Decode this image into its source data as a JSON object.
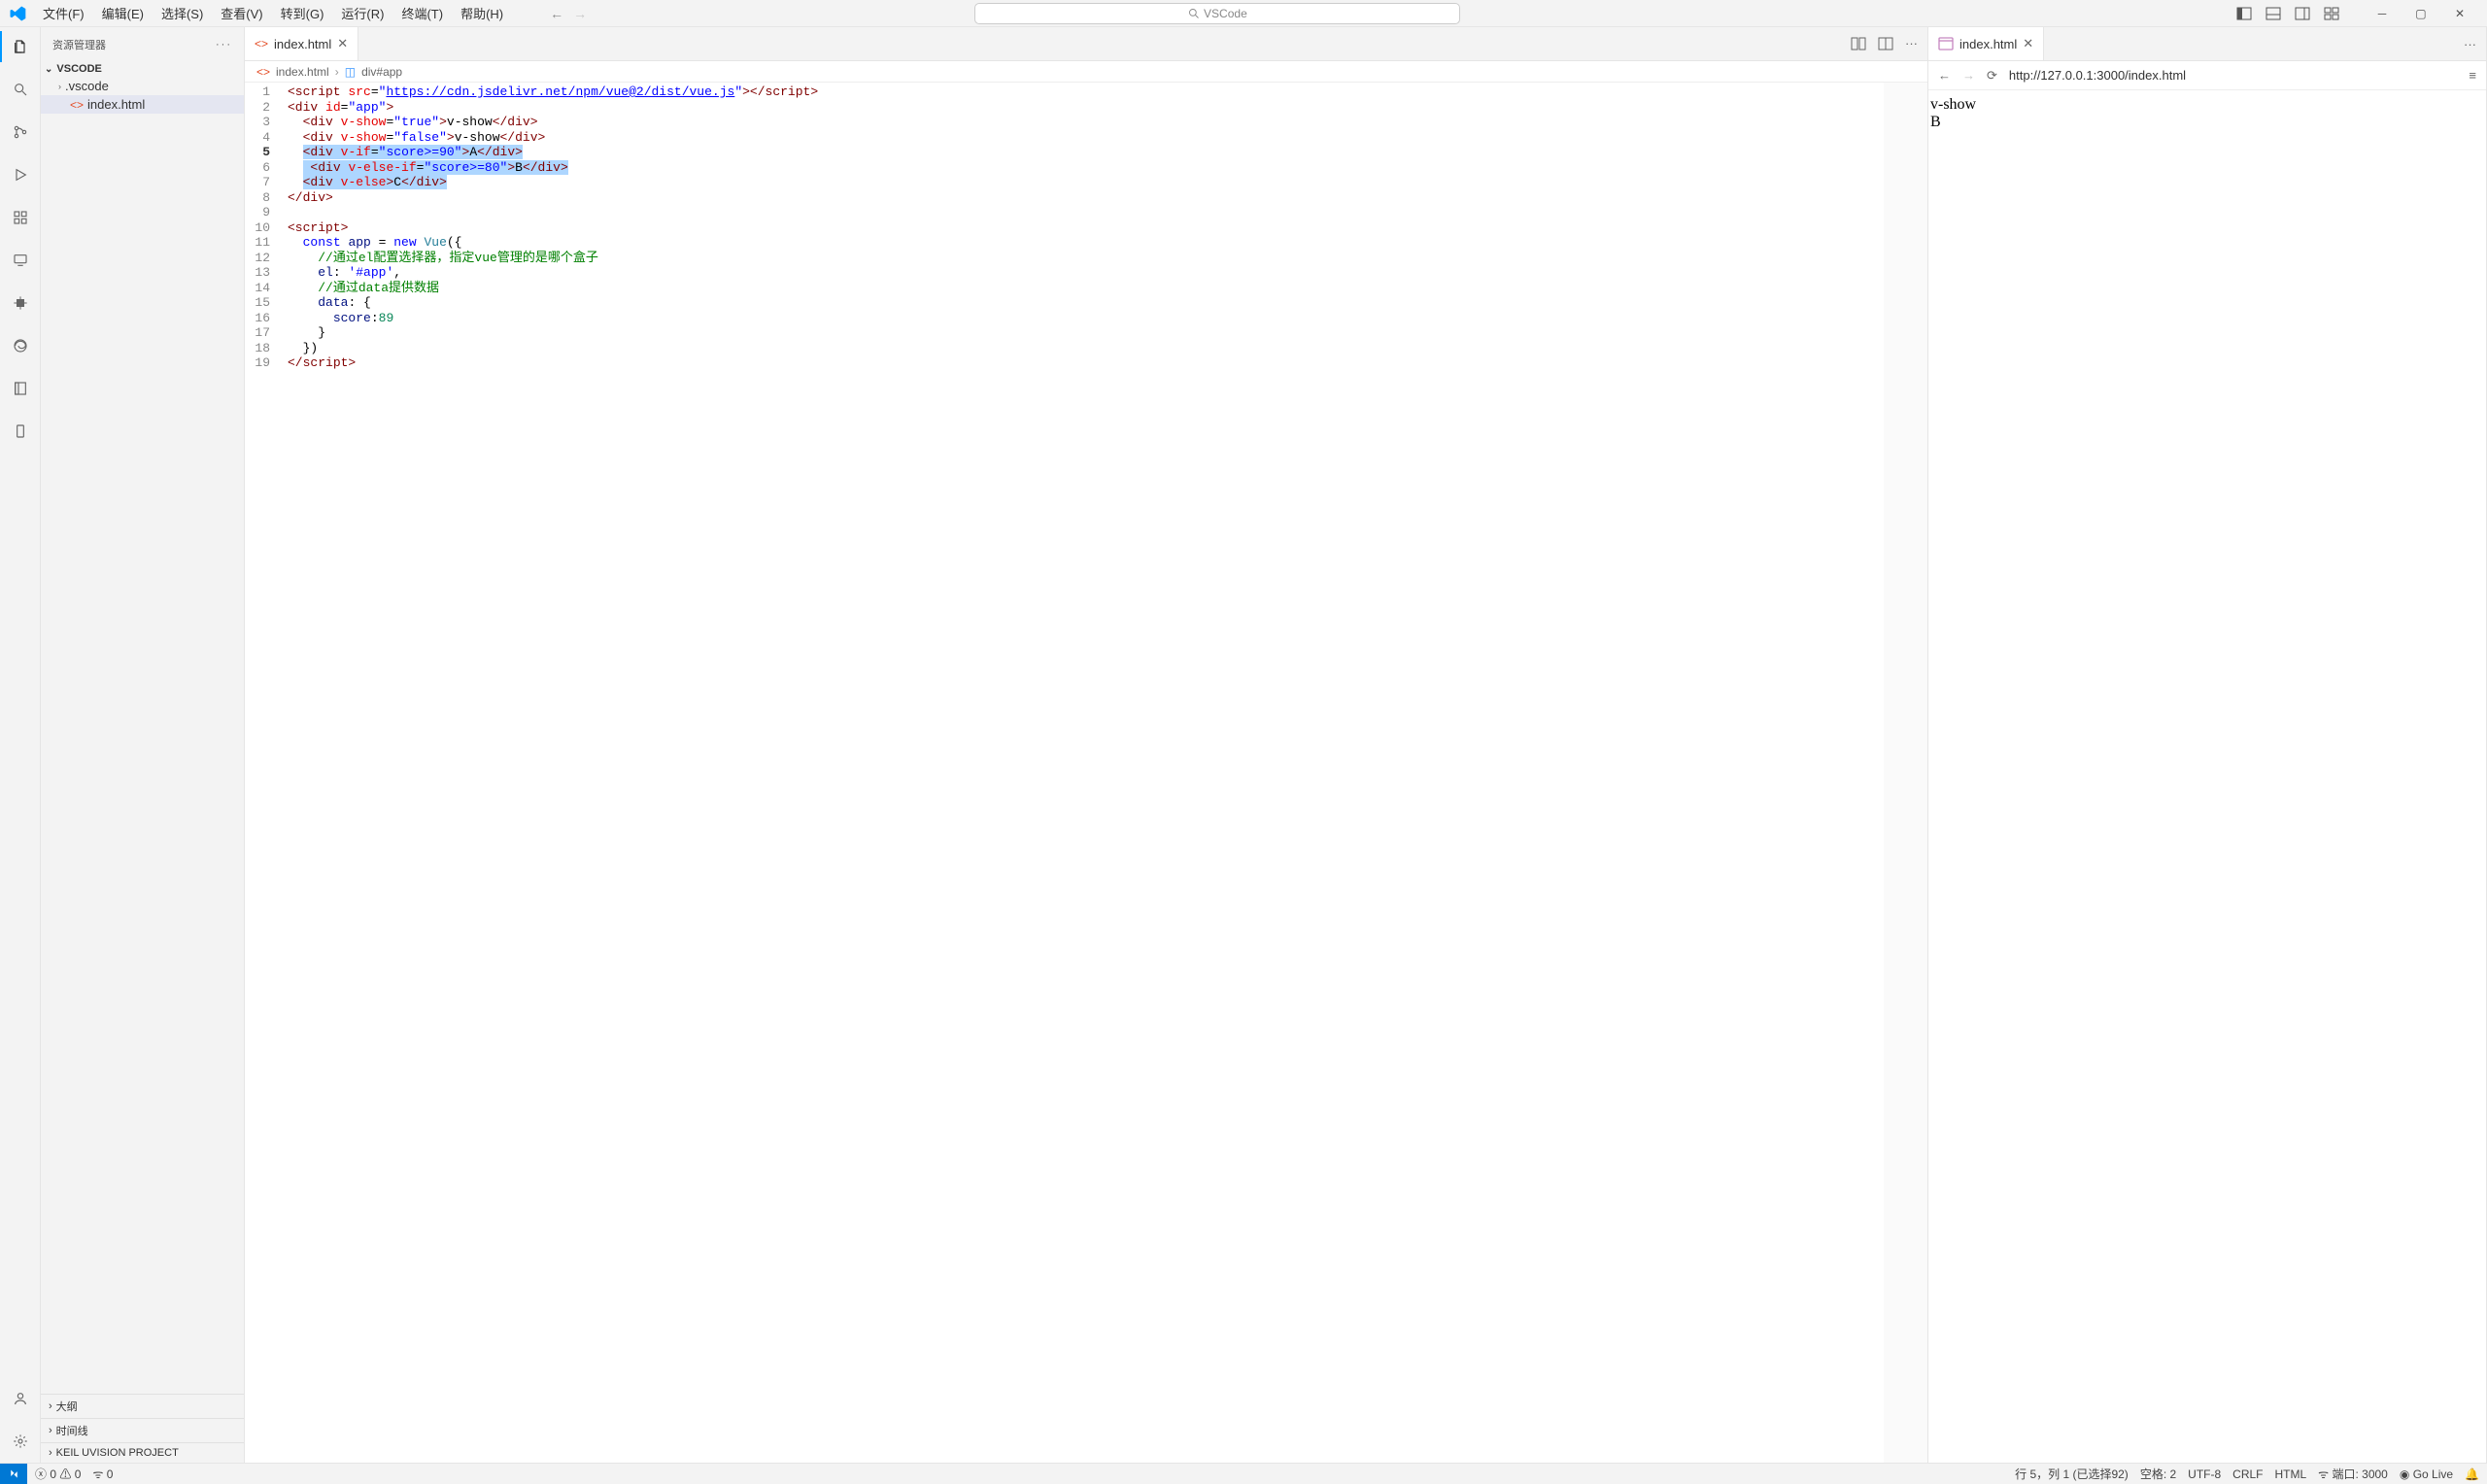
{
  "menu": {
    "file": "文件(F)",
    "edit": "编辑(E)",
    "select": "选择(S)",
    "view": "查看(V)",
    "go": "转到(G)",
    "run": "运行(R)",
    "terminal": "终端(T)",
    "help": "帮助(H)"
  },
  "search_placeholder": "VSCode",
  "sidebar": {
    "title": "资源管理器",
    "root": "VSCODE",
    "items": [
      {
        "label": ".vscode",
        "type": "folder"
      },
      {
        "label": "index.html",
        "type": "file",
        "selected": true
      }
    ],
    "sections": {
      "outline": "大纲",
      "timeline": "时间线",
      "keil": "KEIL UVISION PROJECT"
    }
  },
  "editor_tab": {
    "label": "index.html"
  },
  "breadcrumb": {
    "file": "index.html",
    "symbol": "div#app"
  },
  "code_lines": [
    {
      "n": 1,
      "indent": 0,
      "segs": [
        {
          "c": "t-tag",
          "t": "<script"
        },
        {
          "c": "t-txt",
          "t": " "
        },
        {
          "c": "t-attr",
          "t": "src"
        },
        {
          "c": "t-txt",
          "t": "="
        },
        {
          "c": "t-str",
          "t": "\""
        },
        {
          "c": "t-str t-link",
          "t": "https://cdn.jsdelivr.net/npm/vue@2/dist/vue.js"
        },
        {
          "c": "t-str",
          "t": "\""
        },
        {
          "c": "t-tag",
          "t": "></"
        },
        {
          "c": "t-tag",
          "t": "script"
        },
        {
          "c": "t-tag",
          "t": ">"
        }
      ]
    },
    {
      "n": 2,
      "indent": 0,
      "segs": [
        {
          "c": "t-tag",
          "t": "<div"
        },
        {
          "c": "t-txt",
          "t": " "
        },
        {
          "c": "t-attr",
          "t": "id"
        },
        {
          "c": "t-txt",
          "t": "="
        },
        {
          "c": "t-str",
          "t": "\"app\""
        },
        {
          "c": "t-tag",
          "t": ">"
        }
      ]
    },
    {
      "n": 3,
      "indent": 1,
      "segs": [
        {
          "c": "t-tag",
          "t": "<div"
        },
        {
          "c": "t-txt",
          "t": " "
        },
        {
          "c": "t-attr",
          "t": "v-show"
        },
        {
          "c": "t-txt",
          "t": "="
        },
        {
          "c": "t-str",
          "t": "\"true\""
        },
        {
          "c": "t-tag",
          "t": ">"
        },
        {
          "c": "t-txt",
          "t": "v-show"
        },
        {
          "c": "t-tag",
          "t": "</div>"
        }
      ]
    },
    {
      "n": 4,
      "indent": 1,
      "segs": [
        {
          "c": "t-tag",
          "t": "<div"
        },
        {
          "c": "t-txt",
          "t": " "
        },
        {
          "c": "t-attr",
          "t": "v-show"
        },
        {
          "c": "t-txt",
          "t": "="
        },
        {
          "c": "t-str",
          "t": "\"false\""
        },
        {
          "c": "t-tag",
          "t": ">"
        },
        {
          "c": "t-txt",
          "t": "v-show"
        },
        {
          "c": "t-tag",
          "t": "</div>"
        }
      ]
    },
    {
      "n": 5,
      "indent": 1,
      "sel": true,
      "segs": [
        {
          "c": "t-tag",
          "t": "<div"
        },
        {
          "c": "t-txt",
          "t": " "
        },
        {
          "c": "t-attr",
          "t": "v-if"
        },
        {
          "c": "t-txt",
          "t": "="
        },
        {
          "c": "t-str",
          "t": "\"score>=90\""
        },
        {
          "c": "t-tag",
          "t": ">"
        },
        {
          "c": "t-txt",
          "t": "A"
        },
        {
          "c": "t-tag",
          "t": "</div>"
        }
      ]
    },
    {
      "n": 6,
      "indent": 1,
      "sel": true,
      "segs": [
        {
          "c": "t-txt",
          "t": " "
        },
        {
          "c": "t-tag",
          "t": "<div"
        },
        {
          "c": "t-txt",
          "t": " "
        },
        {
          "c": "t-attr",
          "t": "v-else-if"
        },
        {
          "c": "t-txt",
          "t": "="
        },
        {
          "c": "t-str",
          "t": "\"score>=80\""
        },
        {
          "c": "t-tag",
          "t": ">"
        },
        {
          "c": "t-txt",
          "t": "B"
        },
        {
          "c": "t-tag",
          "t": "</div>"
        }
      ]
    },
    {
      "n": 7,
      "indent": 1,
      "sel": true,
      "segs": [
        {
          "c": "t-tag",
          "t": "<div"
        },
        {
          "c": "t-txt",
          "t": " "
        },
        {
          "c": "t-attr",
          "t": "v-else"
        },
        {
          "c": "t-tag",
          "t": ">"
        },
        {
          "c": "t-txt",
          "t": "C"
        },
        {
          "c": "t-tag",
          "t": "</div>"
        }
      ]
    },
    {
      "n": 8,
      "indent": 0,
      "segs": [
        {
          "c": "t-tag",
          "t": "</div>"
        }
      ]
    },
    {
      "n": 9,
      "indent": 0,
      "segs": [
        {
          "c": "t-txt",
          "t": ""
        }
      ]
    },
    {
      "n": 10,
      "indent": 0,
      "segs": [
        {
          "c": "t-tag",
          "t": "<script>"
        }
      ]
    },
    {
      "n": 11,
      "indent": 1,
      "segs": [
        {
          "c": "t-kw",
          "t": "const"
        },
        {
          "c": "t-txt",
          "t": " "
        },
        {
          "c": "t-id",
          "t": "app"
        },
        {
          "c": "t-txt",
          "t": " = "
        },
        {
          "c": "t-kw",
          "t": "new"
        },
        {
          "c": "t-txt",
          "t": " "
        },
        {
          "c": "t-fn",
          "t": "Vue"
        },
        {
          "c": "t-txt",
          "t": "({"
        }
      ]
    },
    {
      "n": 12,
      "indent": 2,
      "segs": [
        {
          "c": "t-cm",
          "t": "//通过el配置选择器，指定vue管理的是哪个盒子"
        }
      ]
    },
    {
      "n": 13,
      "indent": 2,
      "segs": [
        {
          "c": "t-id",
          "t": "el"
        },
        {
          "c": "t-txt",
          "t": ": "
        },
        {
          "c": "t-str",
          "t": "'#app'"
        },
        {
          "c": "t-txt",
          "t": ","
        }
      ]
    },
    {
      "n": 14,
      "indent": 2,
      "segs": [
        {
          "c": "t-cm",
          "t": "//通过data提供数据"
        }
      ]
    },
    {
      "n": 15,
      "indent": 2,
      "segs": [
        {
          "c": "t-id",
          "t": "data"
        },
        {
          "c": "t-txt",
          "t": ": {"
        }
      ]
    },
    {
      "n": 16,
      "indent": 3,
      "segs": [
        {
          "c": "t-id",
          "t": "score"
        },
        {
          "c": "t-txt",
          "t": ":"
        },
        {
          "c": "t-num",
          "t": "89"
        }
      ]
    },
    {
      "n": 17,
      "indent": 2,
      "segs": [
        {
          "c": "t-txt",
          "t": "}"
        }
      ]
    },
    {
      "n": 18,
      "indent": 1,
      "segs": [
        {
          "c": "t-txt",
          "t": "})"
        }
      ]
    },
    {
      "n": 19,
      "indent": 0,
      "segs": [
        {
          "c": "t-tag",
          "t": "</"
        },
        {
          "c": "t-tag",
          "t": "script"
        },
        {
          "c": "t-tag",
          "t": ">"
        }
      ]
    }
  ],
  "current_line": 5,
  "browser": {
    "tab_label": "index.html",
    "url": "http://127.0.0.1:3000/index.html",
    "content": [
      "v-show",
      "B"
    ]
  },
  "statusbar": {
    "errors": "0",
    "warnings": "0",
    "ports": "0",
    "cursor": "行 5，列 1 (已选择92)",
    "spaces": "空格: 2",
    "encoding": "UTF-8",
    "eol": "CRLF",
    "lang": "HTML",
    "port": "端口: 3000",
    "golive": "Go Live"
  }
}
